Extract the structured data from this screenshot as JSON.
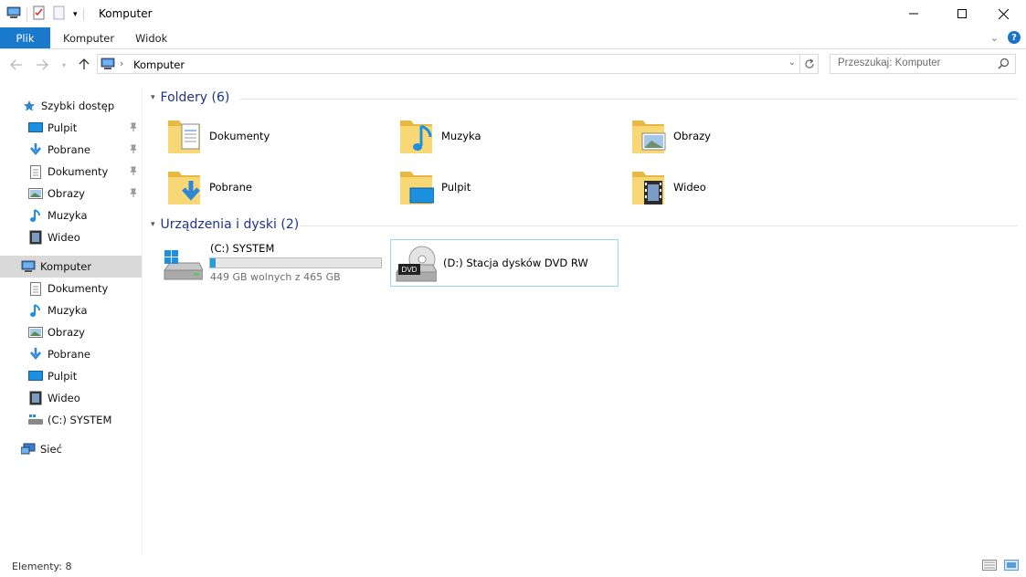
{
  "window": {
    "title": "Komputer"
  },
  "ribbon": {
    "tabs": [
      {
        "label": "Plik"
      },
      {
        "label": "Komputer"
      },
      {
        "label": "Widok"
      }
    ]
  },
  "address": {
    "crumb": "Komputer"
  },
  "search": {
    "placeholder": "Przeszukaj: Komputer"
  },
  "sidebar": {
    "items": [
      {
        "label": "Szybki dostęp",
        "icon": "star-icon"
      },
      {
        "label": "Pulpit",
        "icon": "desktop-icon",
        "pinned": true
      },
      {
        "label": "Pobrane",
        "icon": "download-icon",
        "pinned": true
      },
      {
        "label": "Dokumenty",
        "icon": "document-icon",
        "pinned": true
      },
      {
        "label": "Obrazy",
        "icon": "picture-icon",
        "pinned": true
      },
      {
        "label": "Muzyka",
        "icon": "music-icon"
      },
      {
        "label": "Wideo",
        "icon": "video-icon"
      },
      {
        "label": "Komputer",
        "icon": "computer-icon"
      },
      {
        "label": "Dokumenty",
        "icon": "document-icon"
      },
      {
        "label": "Muzyka",
        "icon": "music-icon"
      },
      {
        "label": "Obrazy",
        "icon": "picture-icon"
      },
      {
        "label": "Pobrane",
        "icon": "download-icon"
      },
      {
        "label": "Pulpit",
        "icon": "desktop-icon"
      },
      {
        "label": "Wideo",
        "icon": "video-icon"
      },
      {
        "label": "(C:) SYSTEM",
        "icon": "drive-icon"
      },
      {
        "label": "Sieć",
        "icon": "network-icon"
      }
    ]
  },
  "folders": {
    "heading": "Foldery (6)",
    "items": [
      {
        "label": "Dokumenty",
        "icon": "documents-folder-icon"
      },
      {
        "label": "Muzyka",
        "icon": "music-folder-icon"
      },
      {
        "label": "Obrazy",
        "icon": "pictures-folder-icon"
      },
      {
        "label": "Pobrane",
        "icon": "downloads-folder-icon"
      },
      {
        "label": "Pulpit",
        "icon": "desktop-folder-icon"
      },
      {
        "label": "Wideo",
        "icon": "videos-folder-icon"
      }
    ]
  },
  "devices": {
    "heading": "Urządzenia i dyski (2)",
    "drive_c": {
      "label": "(C:) SYSTEM",
      "free_text": "449 GB wolnych z 465 GB",
      "used_fraction": 0.034
    },
    "drive_d": {
      "label": "(D:) Stacja dysków DVD RW",
      "badge": "DVD"
    }
  },
  "status": {
    "count": "Elementy: 8"
  },
  "colors": {
    "accent": "#1979ca",
    "heading": "#1e3287",
    "bar_fill": "#26a0da",
    "folder": "#f8d775"
  }
}
